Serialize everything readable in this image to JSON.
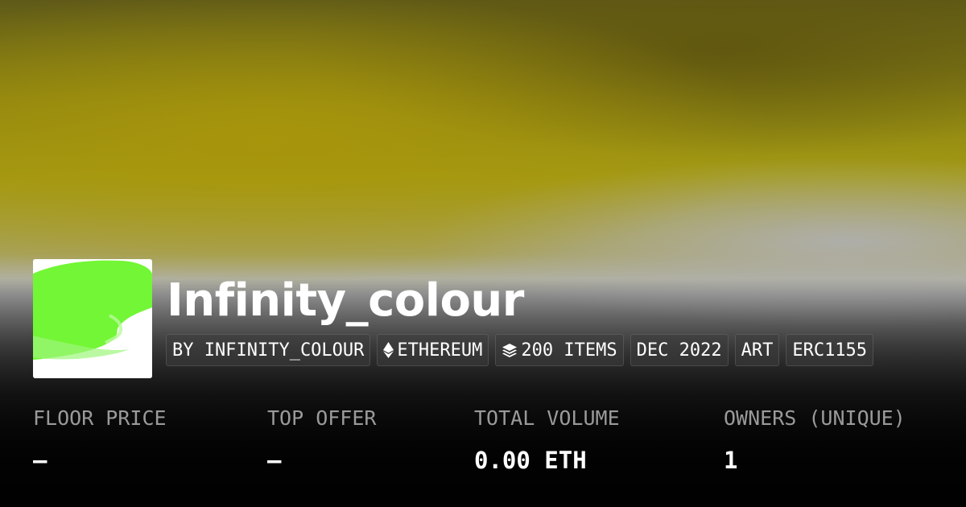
{
  "collection": {
    "name": "Infinity_colour"
  },
  "tags": {
    "creator": "BY INFINITY_COLOUR",
    "chain": "ETHEREUM",
    "items": "200 ITEMS",
    "date": "DEC 2022",
    "category": "ART",
    "standard": "ERC1155"
  },
  "icons": {
    "chain": "ethereum-icon",
    "items": "stack-layers-icon"
  },
  "stats": {
    "floor_price": {
      "label": "FLOOR PRICE",
      "value": "–"
    },
    "top_offer": {
      "label": "TOP OFFER",
      "value": "–"
    },
    "total_volume": {
      "label": "TOTAL VOLUME",
      "value": "0.00 ETH"
    },
    "owners": {
      "label": "OWNERS (UNIQUE)",
      "value": "1"
    }
  },
  "colors": {
    "banner_yellow": "#a39a14",
    "banner_grey": "#a8a8a8",
    "avatar_green": "#6cf52a",
    "label_grey": "#9a9a9a"
  }
}
